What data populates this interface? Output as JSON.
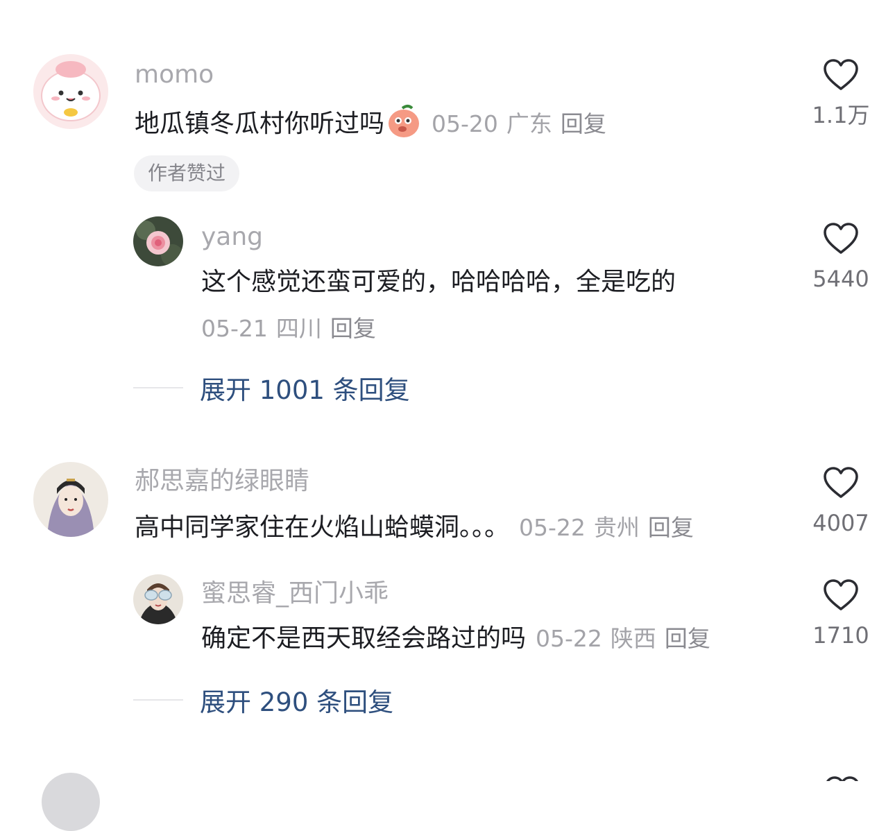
{
  "comments": [
    {
      "username": "momo",
      "text": "地瓜镇冬瓜村你听过吗",
      "date": "05-20",
      "location": "广东",
      "reply_label": "回复",
      "likes": "1.1万",
      "badge": "作者赞过",
      "replies": [
        {
          "username": "yang",
          "text": "这个感觉还蛮可爱的，哈哈哈哈，全是吃的",
          "date": "05-21",
          "location": "四川",
          "reply_label": "回复",
          "likes": "5440"
        }
      ],
      "expand_label": "展开 1001 条回复"
    },
    {
      "username": "郝思嘉的绿眼睛",
      "text": "高中同学家住在火焰山蛤蟆洞。。。",
      "date": "05-22",
      "location": "贵州",
      "reply_label": "回复",
      "likes": "4007",
      "replies": [
        {
          "username": "蜜思睿_西门小乖",
          "text": "确定不是西天取经会路过的吗",
          "date": "05-22",
          "location": "陕西",
          "reply_label": "回复",
          "likes": "1710"
        }
      ],
      "expand_label": "展开 290 条回复"
    }
  ],
  "icons": {
    "like": "heart-outline-icon",
    "emoji": "peach-emoji-icon"
  },
  "colors": {
    "username": "#a8a8ad",
    "text": "#1c1d22",
    "meta": "#a3a3a8",
    "expand_link": "#2e4f7e",
    "badge_bg": "#f2f2f4"
  }
}
